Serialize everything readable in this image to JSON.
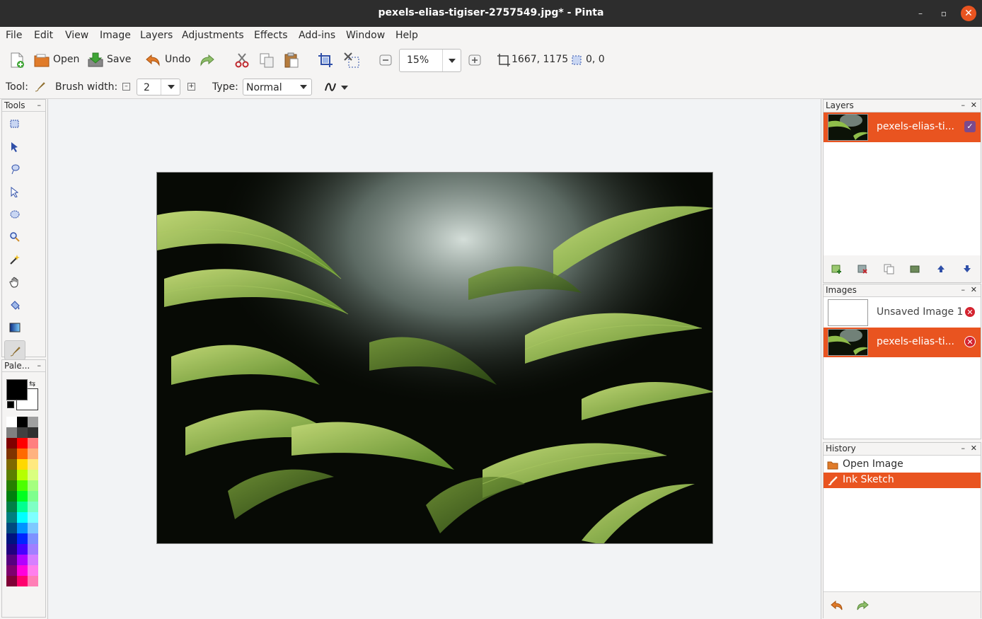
{
  "window": {
    "title": "pexels-elias-tigiser-2757549.jpg* - Pinta",
    "minimize_glyph": "–",
    "maximize_glyph": "▫",
    "close_glyph": "✕"
  },
  "menu": [
    "File",
    "Edit",
    "View",
    "Image",
    "Layers",
    "Adjustments",
    "Effects",
    "Add-ins",
    "Window",
    "Help"
  ],
  "toolbar": {
    "open_label": "Open",
    "save_label": "Save",
    "undo_label": "Undo",
    "zoom_value": "15%",
    "image_size": "1667, 1175",
    "selection_offset": "0, 0"
  },
  "options": {
    "tool_label": "Tool:",
    "brush_width_label": "Brush width:",
    "brush_width_value": "2",
    "type_label": "Type:",
    "type_value": "Normal"
  },
  "tools_panel": {
    "title": "Tools",
    "collapse": "–"
  },
  "palette_panel": {
    "title": "Pale...",
    "collapse": "–"
  },
  "palette_colors": [
    "#ffffff",
    "#000000",
    "#a0a0a0",
    "#808080",
    "#404040",
    "#303030",
    "#7f0000",
    "#ff0000",
    "#ff7f7f",
    "#7f3300",
    "#ff6a00",
    "#ffb27f",
    "#7f6a00",
    "#ffd800",
    "#ffe97f",
    "#5b7f00",
    "#b6ff00",
    "#daff7f",
    "#267f00",
    "#4cff00",
    "#a5ff7f",
    "#007f0e",
    "#00ff21",
    "#7fff8e",
    "#007f46",
    "#00ff90",
    "#7fffc5",
    "#007f7f",
    "#00ffff",
    "#7fffff",
    "#004a7f",
    "#0094ff",
    "#7fc9ff",
    "#00137f",
    "#0026ff",
    "#7f92ff",
    "#21007f",
    "#4800ff",
    "#a17fff",
    "#57007f",
    "#b200ff",
    "#d67fff",
    "#7f006e",
    "#ff00dc",
    "#ff7fed",
    "#7f0037",
    "#ff006e",
    "#ff7fb6"
  ],
  "layers_panel": {
    "title": "Layers",
    "collapse": "–",
    "close": "✕",
    "layers": [
      {
        "name": "pexels-elias-ti...",
        "visible_glyph": "✓"
      }
    ]
  },
  "images_panel": {
    "title": "Images",
    "collapse": "–",
    "close": "✕",
    "images": [
      {
        "name": "Unsaved Image 1",
        "close_glyph": "✕"
      },
      {
        "name": "pexels-elias-ti...",
        "close_glyph": "✕"
      }
    ]
  },
  "history_panel": {
    "title": "History",
    "collapse": "–",
    "close": "✕",
    "items": [
      "Open Image",
      "Ink Sketch"
    ]
  },
  "colors": {
    "accent": "#e95420",
    "titlebar": "#2d2d2d",
    "close_red": "#d4232f"
  }
}
